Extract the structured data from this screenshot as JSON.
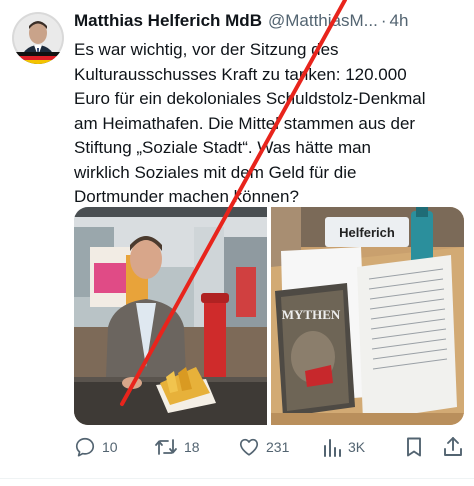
{
  "tweet": {
    "display_name": "Matthias Helferich MdB",
    "handle": "@MatthiasM...",
    "separator": "·",
    "time": "4h",
    "lines": [
      "Es war wichtig, vor der Sitzung des",
      "Kulturausschusses Kraft zu tanken: 120.000",
      "Euro für ein dekoloniales Schuldstolz-Denkmal",
      "am Heimathafen. Die Mittel stammen aus der",
      "Stiftung „Soziale Stadt“. Was hätte man",
      "wirklich Soziales mit dem Geld für die",
      "Dortmunder machen können?"
    ]
  },
  "media": {
    "image2_nameplate": "Helferich",
    "image2_book_title": "MYTHEN"
  },
  "actions": {
    "reply_count": "10",
    "repost_count": "18",
    "like_count": "231",
    "views_count": "3K"
  },
  "colors": {
    "accent": "#1d9bf0",
    "secondary_text": "#536471",
    "strike_red": "#e8241c"
  }
}
